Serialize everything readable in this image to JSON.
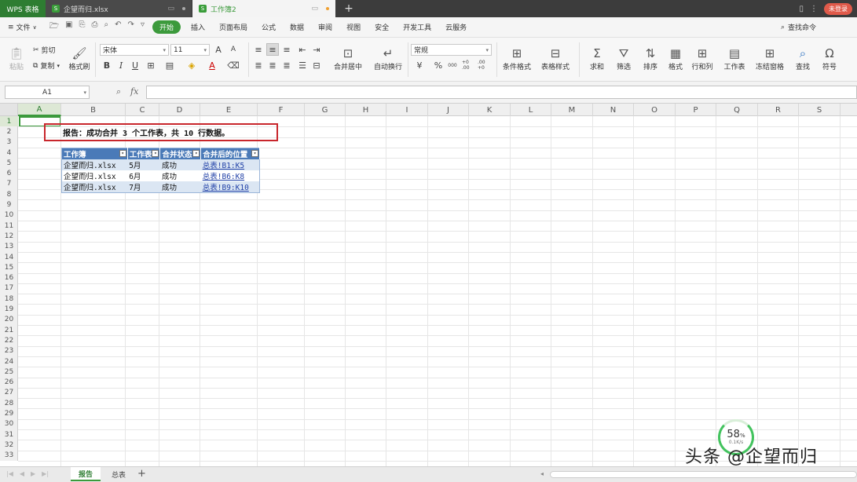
{
  "titlebar": {
    "app": "WPS 表格",
    "tabs": [
      {
        "label": "企望而归.xlsx",
        "icon": "S"
      },
      {
        "label": "工作簿2",
        "icon": "S"
      }
    ],
    "login": "未登录"
  },
  "menubar": {
    "file": "文件",
    "tabs": [
      "开始",
      "插入",
      "页面布局",
      "公式",
      "数据",
      "审阅",
      "视图",
      "安全",
      "开发工具",
      "云服务"
    ],
    "search": "查找命令"
  },
  "ribbon": {
    "paste": "粘贴",
    "cut": "剪切",
    "copy": "复制",
    "format_painter": "格式刷",
    "font": "宋体",
    "font_size": "11",
    "number_format": "常规",
    "merge_center": "合并居中",
    "wrap": "自动换行",
    "cond_format": "条件格式",
    "table_style": "表格样式",
    "sum": "求和",
    "filter": "筛选",
    "sort": "排序",
    "format": "格式",
    "row_col": "行和列",
    "worksheet": "工作表",
    "freeze": "冻结窗格",
    "find": "查找",
    "symbol": "符号",
    "font_grow": "A",
    "font_shrink": "A",
    "bold": "B",
    "italic": "I",
    "underline": "U",
    "font_color": "A",
    "percent": "%",
    "thousands": "000",
    "inc_decimal": "+0 .00",
    "dec_decimal": ".00 +0"
  },
  "formulabar": {
    "cell": "A1",
    "fx": "fx",
    "value": ""
  },
  "columns": [
    "A",
    "B",
    "C",
    "D",
    "E",
    "F",
    "G",
    "H",
    "I",
    "J",
    "K",
    "L",
    "M",
    "N",
    "O",
    "P",
    "Q",
    "R",
    "S"
  ],
  "rows": [
    "1",
    "2",
    "3",
    "4",
    "5",
    "6",
    "7",
    "8",
    "9",
    "10",
    "11",
    "12",
    "13",
    "14",
    "15",
    "16",
    "17",
    "18",
    "19",
    "20",
    "21",
    "22",
    "23",
    "24",
    "25",
    "26",
    "27",
    "28",
    "29",
    "30",
    "31",
    "32",
    "33"
  ],
  "report": "报告：成功合并 3 个工作表，共 10 行数据。",
  "table": {
    "headers": [
      "工作簿",
      "工作表",
      "合并状态",
      "合并后的位置"
    ],
    "rows": [
      [
        "企望而归.xlsx",
        "5月",
        "成功",
        "总表!B1:K5"
      ],
      [
        "企望而归.xlsx",
        "6月",
        "成功",
        "总表!B6:K8"
      ],
      [
        "企望而归.xlsx",
        "7月",
        "成功",
        "总表!B9:K10"
      ]
    ]
  },
  "sheets": {
    "tabs": [
      "报告",
      "总表"
    ],
    "active": "报告"
  },
  "gauge": {
    "percent": "58",
    "unit": "%",
    "speed": "0.1K/s"
  },
  "watermark": "头条 @企望而归"
}
